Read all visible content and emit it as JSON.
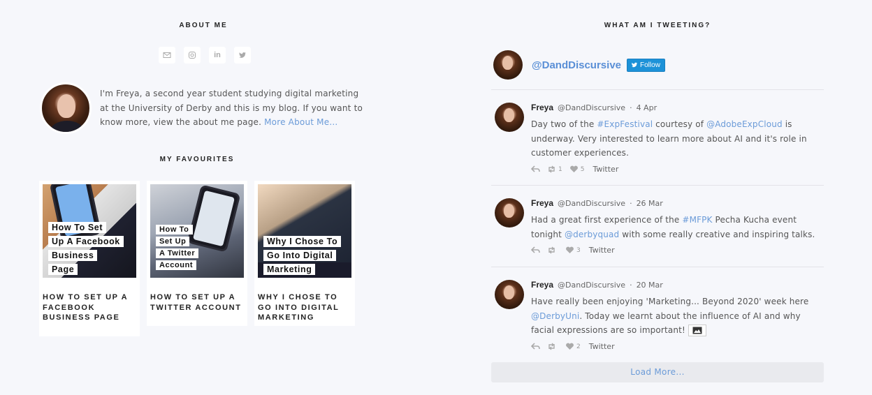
{
  "about": {
    "title": "ABOUT ME",
    "text": "I'm Freya, a second year student studying digital marketing at the University of Derby and this is my blog. If you want to know more, view the about me page. ",
    "more_link": "More About Me..."
  },
  "social": {
    "icons": [
      "mail-icon",
      "instagram-icon",
      "linkedin-icon",
      "twitter-icon"
    ],
    "linkedin_label": "in"
  },
  "favourites": {
    "title": "MY FAVOURITES",
    "items": [
      {
        "overlay": [
          "How To Set",
          "Up A Facebook",
          "Business",
          "Page"
        ],
        "title": "HOW TO SET UP A FACEBOOK BUSINESS PAGE"
      },
      {
        "overlay": [
          "How To",
          "Set Up",
          "A Twitter",
          "Account"
        ],
        "title": "HOW TO SET UP A TWITTER ACCOUNT"
      },
      {
        "overlay": [
          "Why I Chose To",
          "Go Into Digital",
          "Marketing"
        ],
        "title": "WHY I CHOSE TO GO INTO DIGITAL MARKETING"
      }
    ]
  },
  "twitter": {
    "title": "WHAT AM I TWEETING?",
    "handle": "@DandDiscursive",
    "follow_label": "Follow",
    "tweets": [
      {
        "name": "Freya",
        "handle": "@DandDiscursive",
        "sep": "·",
        "date": "4 Apr",
        "t1": "Day two of the ",
        "l1": "#ExpFestival",
        "t2": " courtesy of ",
        "l2": "@AdobeExpCloud",
        "t3": " is underway. Very interested to learn more about AI and it's role in customer experiences.",
        "retweets": "1",
        "likes": "5",
        "source": "Twitter"
      },
      {
        "name": "Freya",
        "handle": "@DandDiscursive",
        "sep": "·",
        "date": "26 Mar",
        "t1": "Had a great first experience of the ",
        "l1": "#MFPK",
        "t2": " Pecha Kucha event tonight ",
        "l2": "@derbyquad",
        "t3": " with some really creative and inspiring talks.",
        "retweets": "",
        "likes": "3",
        "source": "Twitter"
      },
      {
        "name": "Freya",
        "handle": "@DandDiscursive",
        "sep": "·",
        "date": "20 Mar",
        "t1": "Have really been enjoying 'Marketing... Beyond 2020' week here ",
        "l1": "@DerbyUni",
        "t2": ". Today we learnt about the influence of AI and why facial expressions are so important!",
        "retweets": "",
        "likes": "2",
        "source": "Twitter"
      }
    ],
    "load_more": "Load More..."
  },
  "colors": {
    "background": "#f6f7fb",
    "link": "#6b9bd8",
    "follow_button": "#1d92d8"
  }
}
